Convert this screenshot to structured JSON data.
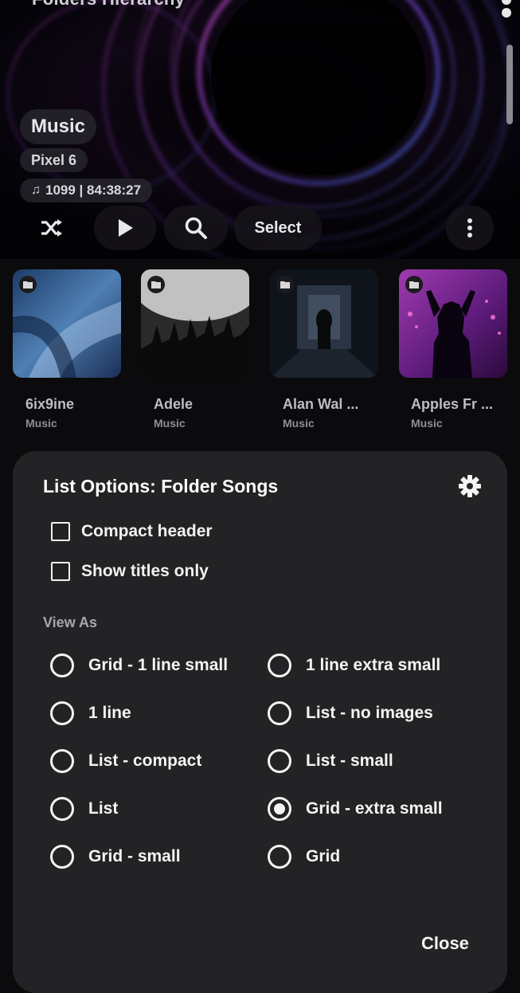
{
  "topbar": {
    "title": "Folders Hierarchy",
    "icon": "folder-icon",
    "menu_icon": "overflow-menu-icon"
  },
  "header": {
    "title": "Music",
    "device": "Pixel 6",
    "stats": "1099 | 84:38:27",
    "stats_icon": "music-note-icon",
    "buttons": {
      "shuffle_icon": "shuffle-icon",
      "play_icon": "play-icon",
      "search_icon": "search-icon",
      "select_label": "Select",
      "more_icon": "more-vertical-icon"
    }
  },
  "folders": [
    {
      "name": "6ix9ine",
      "sub": "Music"
    },
    {
      "name": "Adele",
      "sub": "Music"
    },
    {
      "name": "Alan Wal ...",
      "sub": "Music"
    },
    {
      "name": "Apples Fr ...",
      "sub": "Music"
    }
  ],
  "sheet": {
    "title": "List Options: Folder Songs",
    "settings_icon": "gear-icon",
    "checkboxes": [
      {
        "label": "Compact header",
        "checked": false
      },
      {
        "label": "Show titles only",
        "checked": false
      }
    ],
    "view_as_label": "View As",
    "options": [
      {
        "label": "Grid - 1 line small",
        "selected": false
      },
      {
        "label": "1 line extra small",
        "selected": false
      },
      {
        "label": "1 line",
        "selected": false
      },
      {
        "label": "List - no images",
        "selected": false
      },
      {
        "label": "List - compact",
        "selected": false
      },
      {
        "label": "List - small",
        "selected": false
      },
      {
        "label": "List",
        "selected": false
      },
      {
        "label": "Grid - extra small",
        "selected": true
      },
      {
        "label": "Grid - small",
        "selected": false
      },
      {
        "label": "Grid",
        "selected": false
      }
    ],
    "close_label": "Close"
  },
  "colors": {
    "sheet_bg": "#232325",
    "page_bg": "#0b0b0d",
    "accent_ring_pink": "#c03bb0",
    "accent_ring_blue": "#4a7bd8"
  }
}
